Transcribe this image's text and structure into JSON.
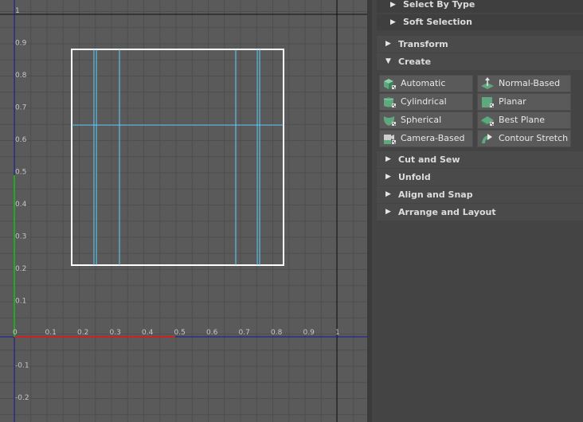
{
  "viewport": {
    "u_ticks": [
      "0",
      "0.1",
      "0.2",
      "0.3",
      "0.4",
      "0.5",
      "0.6",
      "0.7",
      "0.8",
      "0.9",
      "1"
    ],
    "v_ticks": [
      "1",
      "0.9",
      "0.8",
      "0.7",
      "0.6",
      "0.5",
      "0.4",
      "0.3",
      "0.2",
      "0.1",
      "-0.1",
      "-0.2"
    ],
    "colors": {
      "u_axis": "#cc2222",
      "v_axis": "#22aa22",
      "uv_shell": "#ffffff",
      "uv_seam": "#5fd0ff",
      "frame": "#1a1a99"
    }
  },
  "panel": {
    "top_sections": [
      {
        "label": "Select By Type",
        "icon": "triangle-right-icon"
      },
      {
        "label": "Soft Selection",
        "icon": "triangle-right-icon"
      }
    ],
    "sections_before": [
      {
        "label": "Transform",
        "icon": "triangle-right-icon"
      },
      {
        "label": "Create",
        "icon": "triangle-down-icon"
      }
    ],
    "create_buttons": [
      {
        "label": "Automatic",
        "icon": "automatic-icon"
      },
      {
        "label": "Normal-Based",
        "icon": "normal-based-icon"
      },
      {
        "label": "Cylindrical",
        "icon": "cylindrical-icon"
      },
      {
        "label": "Planar",
        "icon": "planar-icon"
      },
      {
        "label": "Spherical",
        "icon": "spherical-icon"
      },
      {
        "label": "Best Plane",
        "icon": "best-plane-icon"
      },
      {
        "label": "Camera-Based",
        "icon": "camera-based-icon"
      },
      {
        "label": "Contour Stretch",
        "icon": "contour-stretch-icon"
      }
    ],
    "sections_after": [
      {
        "label": "Cut and Sew",
        "icon": "triangle-right-icon"
      },
      {
        "label": "Unfold",
        "icon": "triangle-right-icon"
      },
      {
        "label": "Align and Snap",
        "icon": "triangle-right-icon"
      },
      {
        "label": "Arrange and Layout",
        "icon": "triangle-right-icon"
      }
    ],
    "colors": {
      "icon_green": "#5fa87e",
      "icon_dark": "#2f2f2f"
    }
  }
}
